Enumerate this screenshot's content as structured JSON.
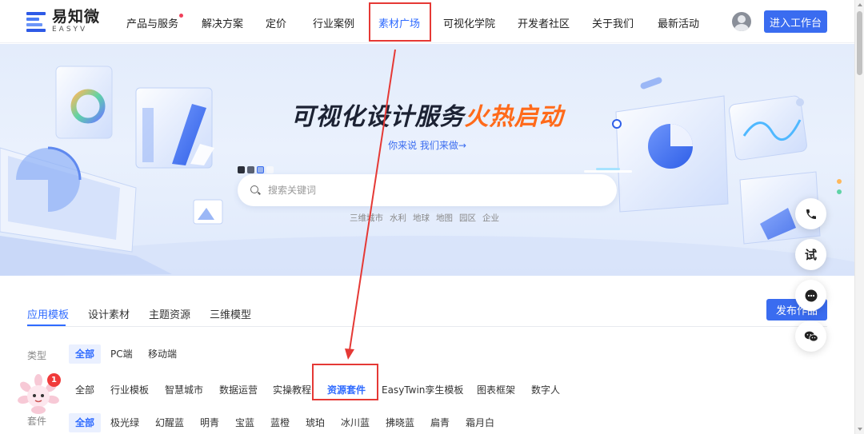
{
  "brand": {
    "name_cn": "易知微",
    "name_en": "EASYV"
  },
  "nav": {
    "items": [
      {
        "label": "产品与服务",
        "has_dot": true
      },
      {
        "label": "解决方案"
      },
      {
        "label": "定价"
      },
      {
        "label": "行业案例"
      },
      {
        "label": "素材广场",
        "active": true
      },
      {
        "label": "可视化学院"
      },
      {
        "label": "开发者社区"
      },
      {
        "label": "关于我们"
      },
      {
        "label": "最新活动"
      }
    ],
    "workbench_label": "进入工作台"
  },
  "hero": {
    "title_part1": "可视化设计服务",
    "title_part2": "火热启动",
    "subtitle": "你来说 我们来做→",
    "search_placeholder": "搜索关键词",
    "hot_tags": [
      "三维城市",
      "水利",
      "地球",
      "地图",
      "园区",
      "企业"
    ]
  },
  "tabs": {
    "items": [
      "应用模板",
      "设计素材",
      "主题资源",
      "三维模型"
    ],
    "active": "应用模板",
    "publish_label": "发布作品"
  },
  "filters": {
    "type_label": "类型",
    "type_options": [
      "全部",
      "PC端",
      "移动端"
    ],
    "category_options": [
      "全部",
      "行业模板",
      "智慧城市",
      "数据运营",
      "实操教程",
      "资源套件",
      "EasyTwin孪生模板",
      "图表框架",
      "数字人"
    ],
    "suite_label": "套件",
    "suite_options": [
      "全部",
      "极光绿",
      "幻醒蓝",
      "明青",
      "宝蓝",
      "蓝橙",
      "琥珀",
      "冰川蓝",
      "拂晓蓝",
      "扁青",
      "霜月白"
    ]
  },
  "float_buttons": [
    {
      "icon": "phone-icon"
    },
    {
      "label": "试"
    },
    {
      "icon": "chat-icon"
    },
    {
      "icon": "wechat-icon"
    }
  ],
  "mascot_badge": "1",
  "colors": {
    "accent": "#3a6cf0",
    "highlight": "#e53935",
    "hero_orange": "#ff6a1a"
  }
}
